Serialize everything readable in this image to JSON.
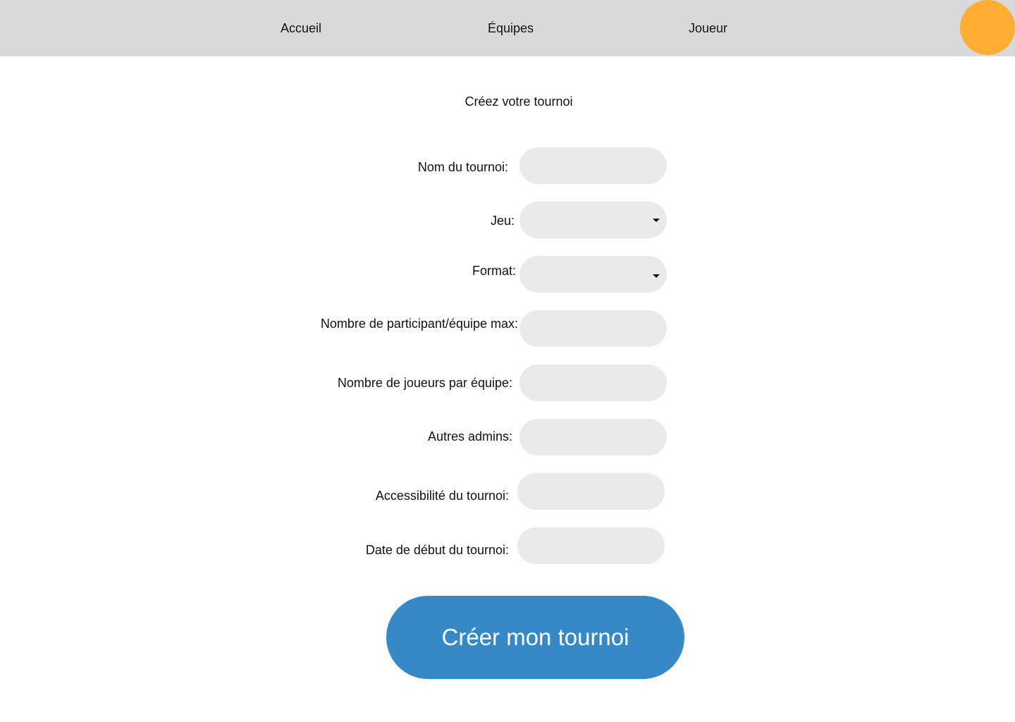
{
  "colors": {
    "topbar_bg": "#d9d9d9",
    "avatar": "#ffad33",
    "field_bg": "#eaeaea",
    "primary_button": "#3589c6"
  },
  "nav": {
    "items": [
      {
        "label": "Accueil"
      },
      {
        "label": "Équipes"
      },
      {
        "label": "Joueur"
      }
    ],
    "avatar_icon": "user-avatar-circle"
  },
  "form": {
    "title": "Créez votre tournoi",
    "fields": {
      "tournament_name": {
        "label": "Nom du tournoi:",
        "value": "",
        "placeholder": ""
      },
      "game": {
        "label": "Jeu:",
        "selected": "",
        "icon": "caret-down-icon"
      },
      "format": {
        "label": "Format:",
        "selected": "",
        "icon": "caret-down-icon"
      },
      "max_participants": {
        "label": "Nombre de participant/équipe max:",
        "value": "",
        "placeholder": ""
      },
      "players_per_team": {
        "label": "Nombre de joueurs par équipe:",
        "value": "",
        "placeholder": ""
      },
      "other_admins": {
        "label": "Autres admins:",
        "value": "",
        "placeholder": ""
      },
      "accessibility": {
        "label": "Accessibilité du tournoi:",
        "value": "",
        "placeholder": ""
      },
      "start_date": {
        "label": "Date de début du tournoi:",
        "value": "",
        "placeholder": ""
      }
    },
    "submit_label": "Créer mon tournoi"
  }
}
